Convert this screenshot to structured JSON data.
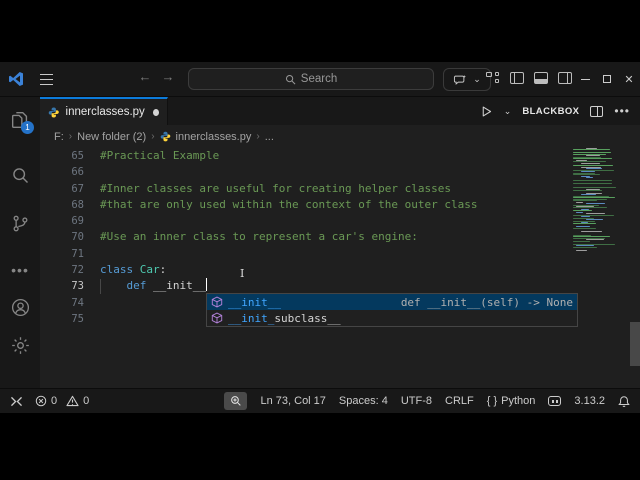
{
  "colors": {
    "accent": "#0c7bda",
    "selection_bg": "#04395e",
    "match_blue": "#40a6ff",
    "comment": "#6A9955",
    "keyword": "#569CD6",
    "class_name": "#4EC9B0",
    "plain": "#d4d4d4",
    "badge_bg": "#2472c8"
  },
  "titlebar": {
    "search_label": "Search",
    "back_glyph": "←",
    "forward_glyph": "→"
  },
  "activitybar": {
    "explorer_badge": "1"
  },
  "tabbar": {
    "tab_label": "innerclasses.py",
    "run_label": "BLACKBOX"
  },
  "breadcrumb": {
    "drive": "F:",
    "folder": "New folder (2)",
    "file": "innerclasses.py",
    "more": "...",
    "sep": "›"
  },
  "editor": {
    "lines": [
      {
        "num": "65",
        "segs": [
          {
            "t": "#Practical Example",
            "c": "cm"
          }
        ]
      },
      {
        "num": "66",
        "segs": []
      },
      {
        "num": "67",
        "segs": [
          {
            "t": "#Inner classes are useful for creating helper classes",
            "c": "cm"
          }
        ]
      },
      {
        "num": "68",
        "segs": [
          {
            "t": "#that are only used within the context of the outer class",
            "c": "cm"
          }
        ]
      },
      {
        "num": "69",
        "segs": []
      },
      {
        "num": "70",
        "segs": [
          {
            "t": "#Use an inner class to represent a car's engine:",
            "c": "cm"
          }
        ]
      },
      {
        "num": "71",
        "segs": []
      },
      {
        "num": "72",
        "segs": [
          {
            "t": "class ",
            "c": "kw"
          },
          {
            "t": "Car",
            "c": "cls"
          },
          {
            "t": ":",
            "c": "pl"
          }
        ]
      },
      {
        "num": "73",
        "active": true,
        "guide": true,
        "cursor": true,
        "segs": [
          {
            "t": "    ",
            "c": "pl"
          },
          {
            "t": "def ",
            "c": "kw"
          },
          {
            "t": "__init__",
            "c": "pl"
          }
        ]
      },
      {
        "num": "74",
        "segs": []
      },
      {
        "num": "75",
        "segs": []
      }
    ]
  },
  "suggest": {
    "items": [
      {
        "match": "__init__",
        "rest": "",
        "detail": "def __init__(self) -> None",
        "selected": true
      },
      {
        "match": "__init_",
        "rest": "subclass__",
        "detail": "",
        "selected": false
      }
    ]
  },
  "statusbar": {
    "errors": "0",
    "warnings": "0",
    "cursor_position": "Ln 73, Col 17",
    "indentation": "Spaces: 4",
    "encoding": "UTF-8",
    "eol": "CRLF",
    "lang_brackets": "{ }",
    "language": "Python",
    "python_version": "3.13.2"
  }
}
